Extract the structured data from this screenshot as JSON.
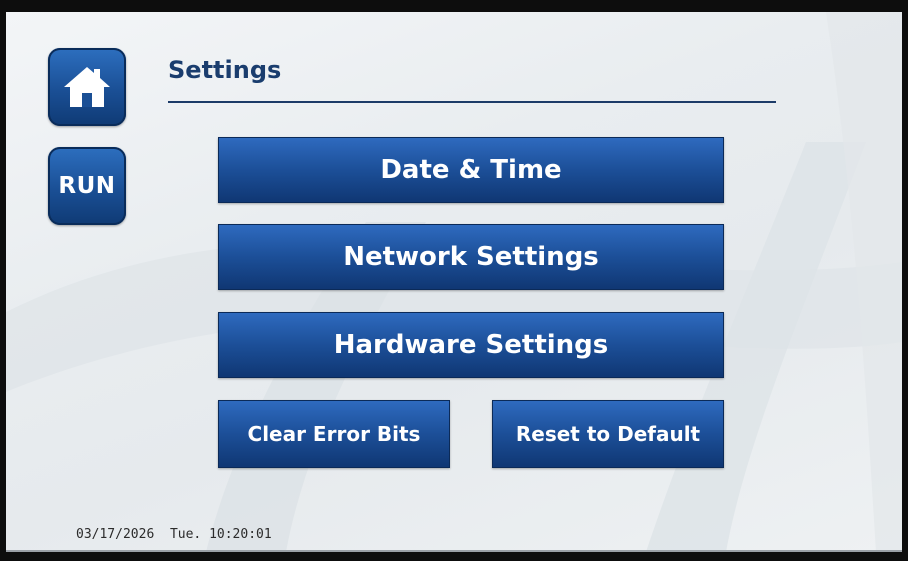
{
  "header": {
    "title": "Settings"
  },
  "nav": {
    "home_icon": "home-icon",
    "run_label": "RUN"
  },
  "menu": {
    "date_time": "Date & Time",
    "network": "Network Settings",
    "hardware": "Hardware Settings",
    "clear_errors": "Clear Error Bits",
    "reset_default": "Reset to Default"
  },
  "status": {
    "date": "03/17/2026",
    "day": "Tue.",
    "time": "10:20:01"
  },
  "colors": {
    "button_top": "#2f6bc0",
    "button_bottom": "#0f3672",
    "title_text": "#1a3d6e",
    "background": "#eceff2"
  }
}
